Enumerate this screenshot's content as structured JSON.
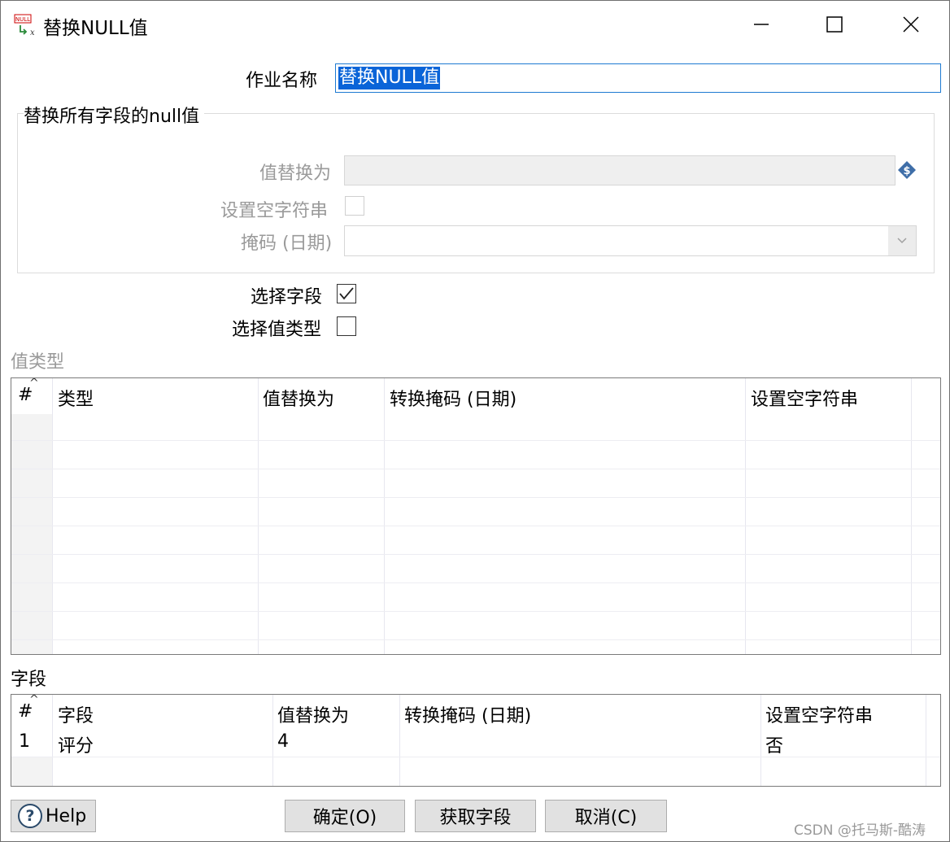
{
  "window": {
    "title": "替换NULL值",
    "icon_name": "replace-null-icon",
    "icon_text": "NULL",
    "icon_subtext": "x"
  },
  "form": {
    "job_name_label": "作业名称",
    "job_name_value": "替换NULL值",
    "group_title": "替换所有字段的null值",
    "replace_with_label": "值替换为",
    "set_empty_string_label": "设置空字符串",
    "set_empty_string_checked": false,
    "mask_label": "掩码 (日期)",
    "select_fields_label": "选择字段",
    "select_fields_checked": true,
    "select_value_type_label": "选择值类型",
    "select_value_type_checked": false
  },
  "value_types": {
    "section_title": "值类型",
    "columns": [
      "#",
      "类型",
      "值替换为",
      "转换掩码 (日期)",
      "设置空字符串"
    ],
    "rows": []
  },
  "fields": {
    "section_title": "字段",
    "columns": [
      "#",
      "字段",
      "值替换为",
      "转换掩码 (日期)",
      "设置空字符串"
    ],
    "rows": [
      {
        "num": "1",
        "field": "评分",
        "replace_with": "4",
        "mask": "",
        "set_empty": "否"
      }
    ]
  },
  "buttons": {
    "help": "Help",
    "ok": "确定(O)",
    "get_fields": "获取字段",
    "cancel": "取消(C)"
  },
  "watermark": "CSDN @托马斯-酷涛",
  "colors": {
    "selection": "#0a64d8",
    "focus_border": "#1e7ad2",
    "disabled_text": "#9a9a9a",
    "button_bg": "#e1e1e1"
  }
}
